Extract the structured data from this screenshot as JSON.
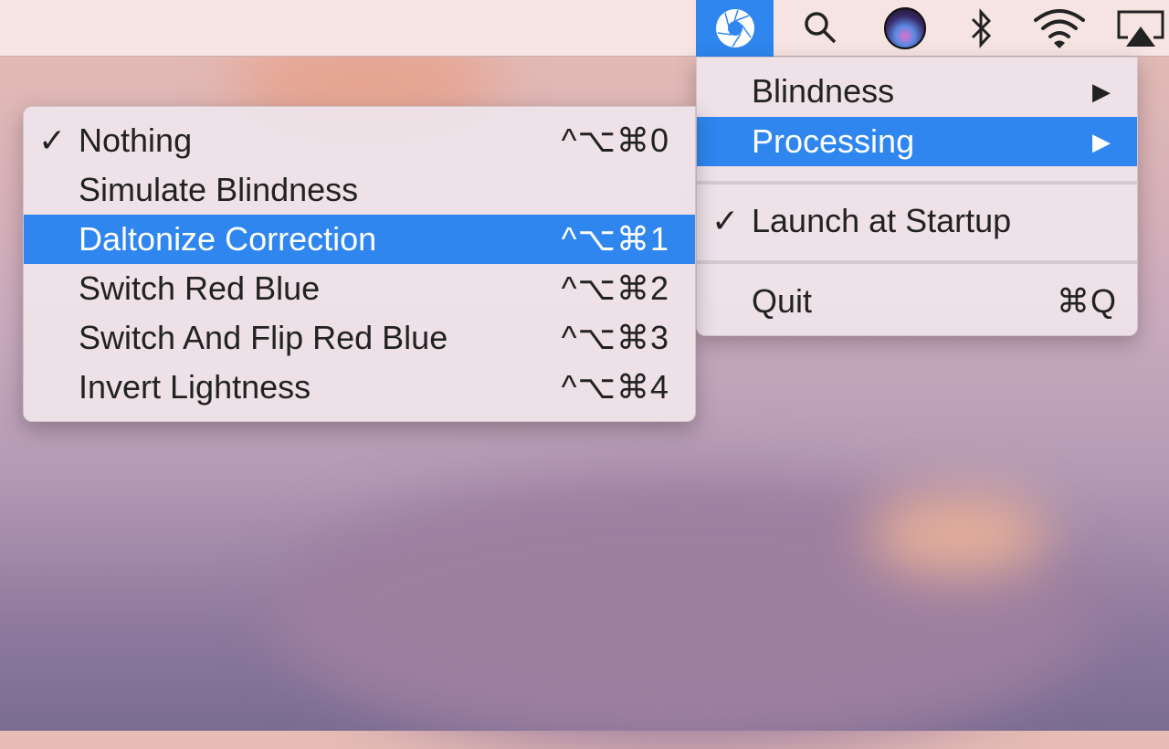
{
  "menubar": {
    "icons": [
      "app-aperture-icon",
      "search-icon",
      "siri-icon",
      "bluetooth-icon",
      "wifi-icon",
      "airplay-icon"
    ],
    "accent": "#2f86ef"
  },
  "main_menu": {
    "items": [
      {
        "label": "Blindness",
        "submenu": true
      },
      {
        "label": "Processing",
        "submenu": true,
        "highlighted": true
      },
      {
        "label": "Launch at Startup",
        "checked": true
      },
      {
        "label": "Quit",
        "shortcut": "⌘Q"
      }
    ],
    "arrow": "▶",
    "check": "✓"
  },
  "processing_menu": {
    "items": [
      {
        "label": "Nothing",
        "shortcut": "^⌥⌘0",
        "checked": true
      },
      {
        "label": "Simulate Blindness",
        "shortcut": ""
      },
      {
        "label": "Daltonize Correction",
        "shortcut": "^⌥⌘1",
        "highlighted": true
      },
      {
        "label": "Switch Red Blue",
        "shortcut": "^⌥⌘2"
      },
      {
        "label": "Switch And Flip Red Blue",
        "shortcut": "^⌥⌘3"
      },
      {
        "label": "Invert Lightness",
        "shortcut": "^⌥⌘4"
      }
    ],
    "check": "✓"
  }
}
